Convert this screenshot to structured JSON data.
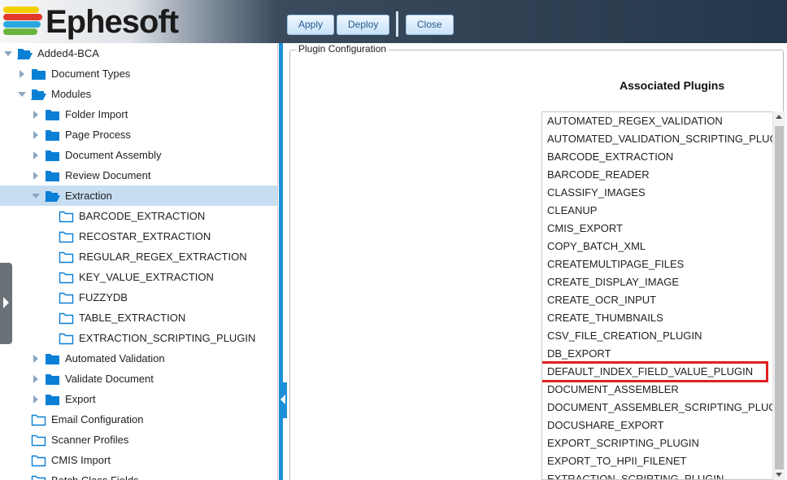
{
  "header": {
    "logo_text": "Ephesoft",
    "buttons": {
      "apply": "Apply",
      "deploy": "Deploy",
      "close": "Close"
    },
    "logo_colors": [
      "#f4d000",
      "#e23b2e",
      "#2aa7df",
      "#6ab43e"
    ]
  },
  "tree": {
    "items": [
      {
        "label": "Added4-BCA",
        "icon": "folder-open-icon",
        "twisty": "down"
      },
      {
        "label": "Document Types",
        "icon": "folder-icon",
        "twisty": "right"
      },
      {
        "label": "Modules",
        "icon": "folder-open-icon",
        "twisty": "down"
      },
      {
        "label": "Folder Import",
        "icon": "folder-icon",
        "twisty": "right"
      },
      {
        "label": "Page Process",
        "icon": "folder-icon",
        "twisty": "right"
      },
      {
        "label": "Document Assembly",
        "icon": "folder-icon",
        "twisty": "right"
      },
      {
        "label": "Review Document",
        "icon": "folder-icon",
        "twisty": "right"
      },
      {
        "label": "Extraction",
        "icon": "folder-open-icon",
        "twisty": "down",
        "selected": true
      },
      {
        "label": "BARCODE_EXTRACTION",
        "icon": "folder-outline-icon",
        "twisty": "none"
      },
      {
        "label": "RECOSTAR_EXTRACTION",
        "icon": "folder-outline-icon",
        "twisty": "none"
      },
      {
        "label": "REGULAR_REGEX_EXTRACTION",
        "icon": "folder-outline-icon",
        "twisty": "none"
      },
      {
        "label": "KEY_VALUE_EXTRACTION",
        "icon": "folder-outline-icon",
        "twisty": "none"
      },
      {
        "label": "FUZZYDB",
        "icon": "folder-outline-icon",
        "twisty": "none"
      },
      {
        "label": "TABLE_EXTRACTION",
        "icon": "folder-outline-icon",
        "twisty": "none"
      },
      {
        "label": "EXTRACTION_SCRIPTING_PLUGIN",
        "icon": "folder-outline-icon",
        "twisty": "none"
      },
      {
        "label": "Automated Validation",
        "icon": "folder-icon",
        "twisty": "right"
      },
      {
        "label": "Validate Document",
        "icon": "folder-icon",
        "twisty": "right"
      },
      {
        "label": "Export",
        "icon": "folder-icon",
        "twisty": "right"
      },
      {
        "label": "Email Configuration",
        "icon": "folder-outline-icon",
        "twisty": "none"
      },
      {
        "label": "Scanner Profiles",
        "icon": "folder-outline-icon",
        "twisty": "none"
      },
      {
        "label": "CMIS Import",
        "icon": "folder-outline-icon",
        "twisty": "none"
      },
      {
        "label": "Batch Class Fields",
        "icon": "folder-outline-icon",
        "twisty": "none"
      }
    ]
  },
  "panel": {
    "legend": "Plugin Configuration",
    "associated_title": "Associated Plugins",
    "plugins": [
      "AUTOMATED_REGEX_VALIDATION",
      "AUTOMATED_VALIDATION_SCRIPTING_PLUGIN",
      "BARCODE_EXTRACTION",
      "BARCODE_READER",
      "CLASSIFY_IMAGES",
      "CLEANUP",
      "CMIS_EXPORT",
      "COPY_BATCH_XML",
      "CREATEMULTIPAGE_FILES",
      "CREATE_DISPLAY_IMAGE",
      "CREATE_OCR_INPUT",
      "CREATE_THUMBNAILS",
      "CSV_FILE_CREATION_PLUGIN",
      "DB_EXPORT",
      "DEFAULT_INDEX_FIELD_VALUE_PLUGIN",
      "DOCUMENT_ASSEMBLER",
      "DOCUMENT_ASSEMBLER_SCRIPTING_PLUGIN",
      "DOCUSHARE_EXPORT",
      "EXPORT_SCRIPTING_PLUGIN",
      "EXPORT_TO_HPII_FILENET",
      "EXTRACTION_SCRIPTING_PLUGIN"
    ],
    "highlighted_plugin": "DEFAULT_INDEX_FIELD_VALUE_PLUGIN",
    "highlight_color": "#e02020",
    "accent_color": "#1d8fd8",
    "folder_color": "#0a7fd6"
  }
}
